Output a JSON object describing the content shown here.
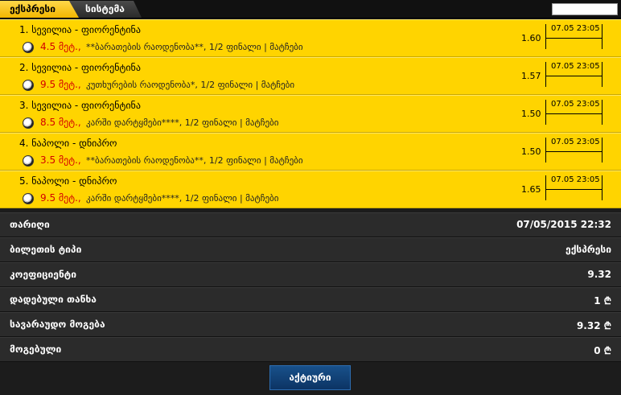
{
  "tabs": [
    {
      "label": "ექსპრესი"
    },
    {
      "label": "სისტემა"
    }
  ],
  "bets": [
    {
      "title": "1. სევილია - ფიორენტინა",
      "odd": "4.5 მეტ.,",
      "market": "**ბარათების რაოდენობა**, 1/2 ფინალი | მატჩები",
      "coef": "1.60",
      "date": "07.05 23:05"
    },
    {
      "title": "2. სევილია - ფიორენტინა",
      "odd": "9.5 მეტ.,",
      "market": "კუთხურების რაოდენობა*, 1/2 ფინალი | მატჩები",
      "coef": "1.57",
      "date": "07.05 23:05"
    },
    {
      "title": "3. სევილია - ფიორენტინა",
      "odd": "8.5 მეტ.,",
      "market": "კარში დარტყმები****, 1/2 ფინალი | მატჩები",
      "coef": "1.50",
      "date": "07.05 23:05"
    },
    {
      "title": "4. ნაპოლი - დნიპრო",
      "odd": "3.5 მეტ.,",
      "market": "**ბარათების რაოდენობა**, 1/2 ფინალი | მატჩები",
      "coef": "1.50",
      "date": "07.05 23:05"
    },
    {
      "title": "5. ნაპოლი - დნიპრო",
      "odd": "9.5 მეტ.,",
      "market": "კარში დარტყმები****, 1/2 ფინალი | მატჩები",
      "coef": "1.65",
      "date": "07.05 23:05"
    }
  ],
  "info": {
    "date_label": "თარიღი",
    "date_value": "07/05/2015 22:32",
    "type_label": "ბილეთის ტიპი",
    "type_value": "ექსპრესი",
    "coef_label": "კოეფიციენტი",
    "coef_value": "9.32",
    "stake_label": "დადებული თანხა",
    "stake_value": "1 ₾",
    "potential_label": "სავარაუდო მოგება",
    "potential_value": "9.32 ₾",
    "won_label": "მოგებული",
    "won_value": "0 ₾"
  },
  "footer": {
    "status_button": "აქტიური"
  },
  "colors": {
    "bet_bg": "#ffd400",
    "odd_red": "#d40000",
    "button_blue": "#0c3464"
  }
}
